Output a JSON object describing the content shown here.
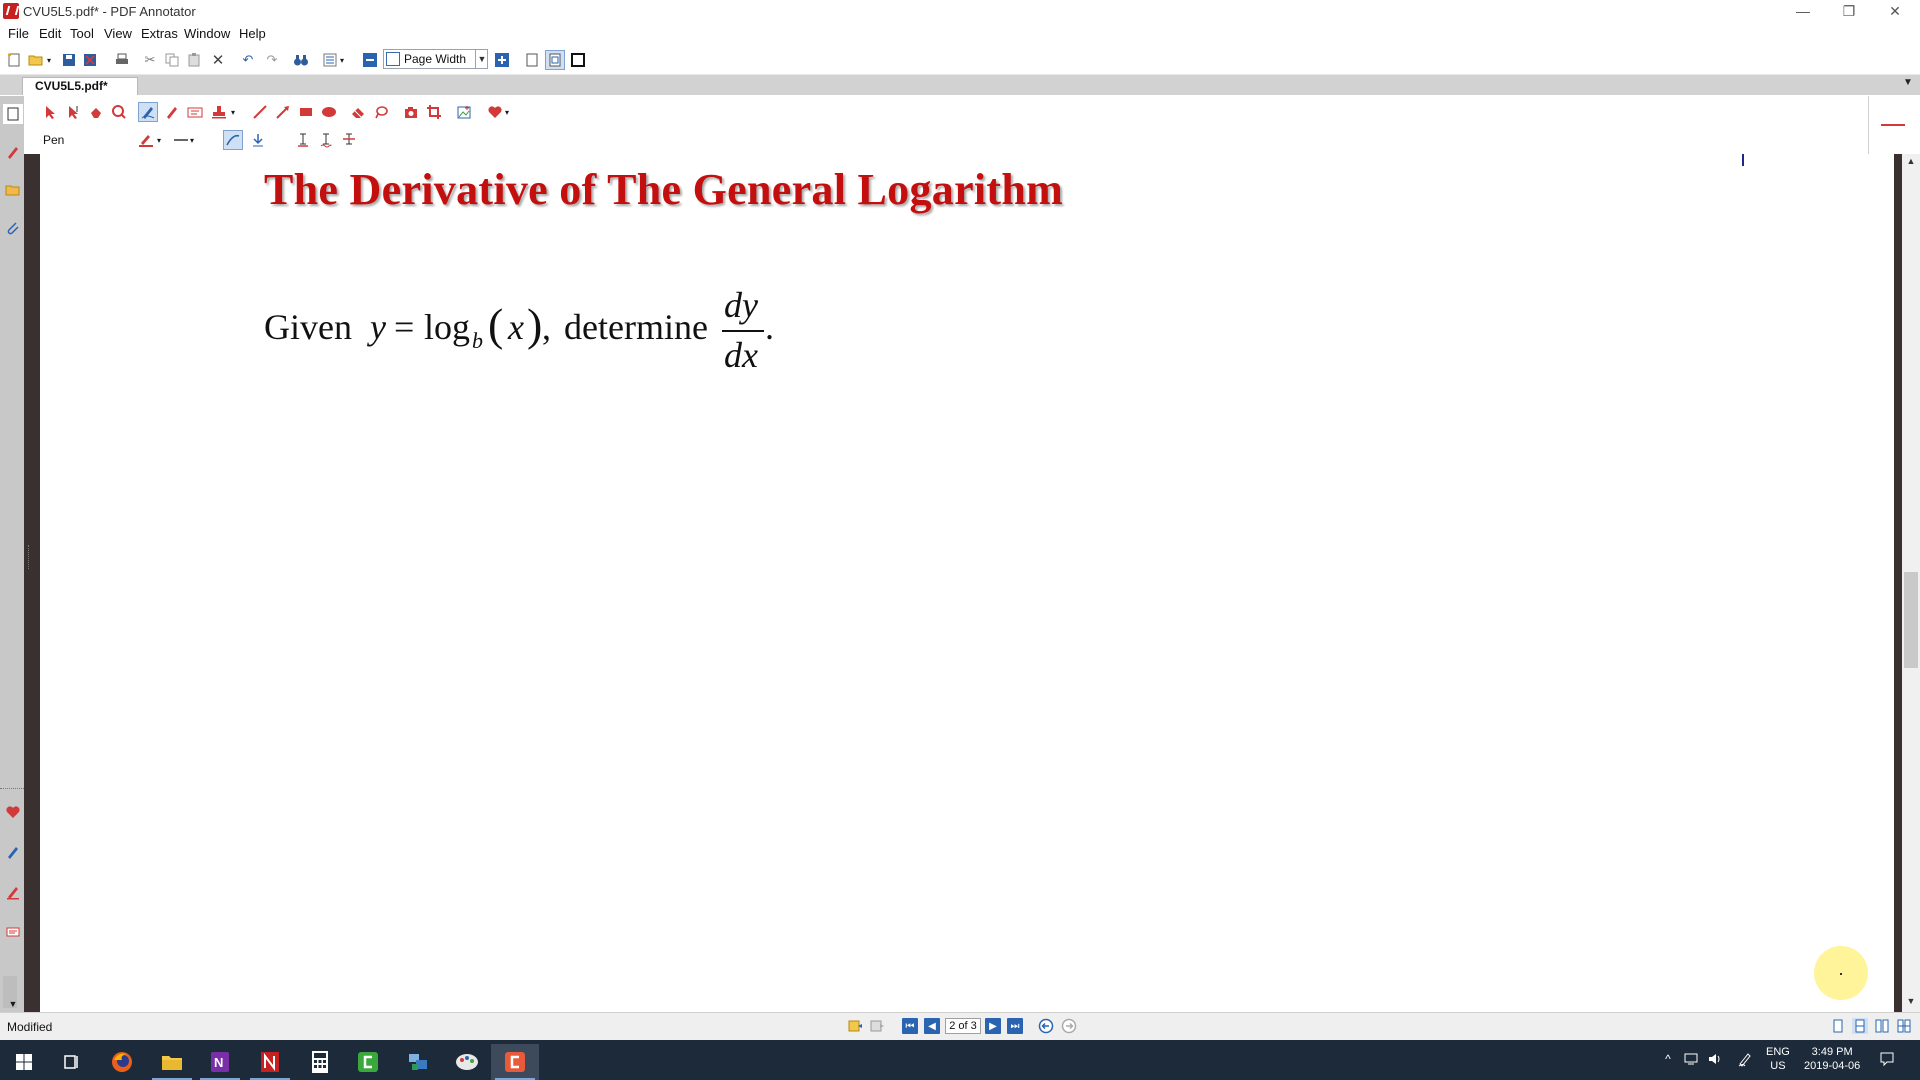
{
  "window": {
    "title": "CVU5L5.pdf* - PDF Annotator",
    "minimize_icon": "minimize-icon",
    "restore_icon": "restore-icon",
    "close_icon": "close-icon"
  },
  "menu": [
    "File",
    "Edit",
    "Tool",
    "View",
    "Extras",
    "Window",
    "Help"
  ],
  "toolbar": {
    "zoom_label": "Page Width"
  },
  "tab": {
    "label": "CVU5L5.pdf*"
  },
  "annotation_toolbar": {
    "current_tool_label": "Pen",
    "accent_color": "#d23a3a"
  },
  "document": {
    "title": "The Derivative of The General Logarithm",
    "title_color": "#c40f0f",
    "equation": {
      "given": "Given",
      "y": "y",
      "equals": "=",
      "log": "log",
      "base": "b",
      "lparen": "(",
      "x": "x",
      "rparen": ")",
      "comma": ",",
      "determine": "determine",
      "numerator": "dy",
      "denominator": "dx",
      "period": "."
    }
  },
  "status": {
    "text": "Modified",
    "page_indicator": "2 of 3"
  },
  "taskbar": {
    "lang_top": "ENG",
    "lang_bottom": "US",
    "time": "3:49 PM",
    "date": "2019-04-06"
  }
}
